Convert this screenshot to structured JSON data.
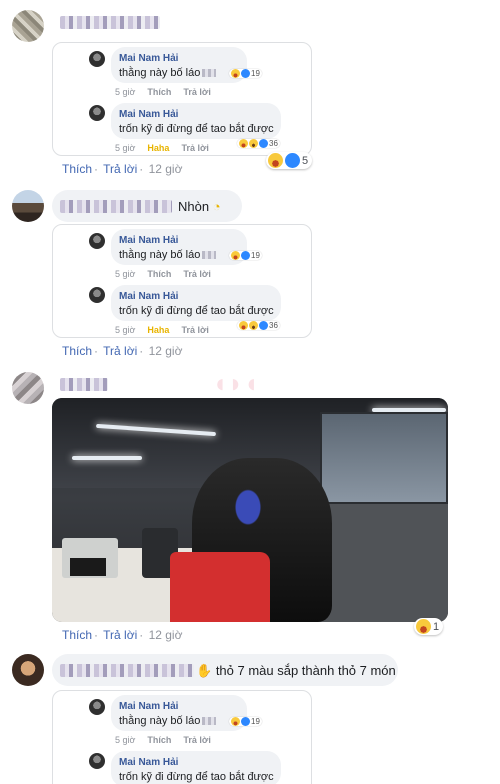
{
  "comment_box": {
    "replies": [
      {
        "author": "Mai Nam Hải",
        "text": "thằng này bố láo",
        "time": "5 giờ",
        "like": "Thích",
        "reply": "Trả lời",
        "count": "19"
      },
      {
        "author": "Mai Nam Hải",
        "text": "trốn kỹ đi đừng để tao bắt được",
        "time": "5 giờ",
        "like": "Haha",
        "reply": "Trả lời",
        "count": "36"
      }
    ]
  },
  "comments": [
    {
      "actions": {
        "like": "Thích",
        "reply": "Trả lời",
        "time": "12 giờ"
      },
      "reaction_count": "5"
    },
    {
      "text": "Nhòn",
      "actions": {
        "like": "Thích",
        "reply": "Trả lời",
        "time": "12 giờ"
      }
    },
    {
      "actions": {
        "like": "Thích",
        "reply": "Trả lời",
        "time": "12 giờ"
      },
      "reaction_count": "1"
    },
    {
      "text": "thỏ 7 màu sắp thành thỏ 7 món"
    }
  ],
  "colors": {
    "link": "#4267b2",
    "name": "#385898",
    "bubble": "#f0f2f5",
    "meta": "#90949c",
    "haha": "#e8b400"
  }
}
